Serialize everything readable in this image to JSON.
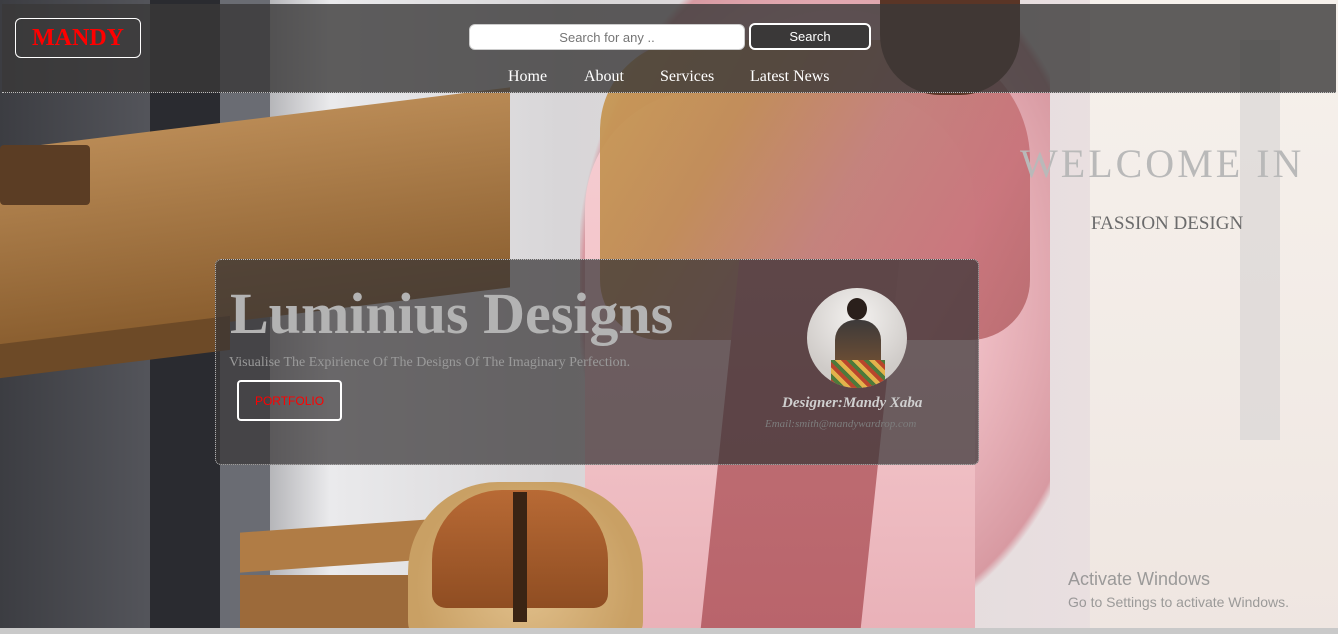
{
  "logo": {
    "text": "MANDY"
  },
  "search": {
    "placeholder": "Search for any ..",
    "button_label": "Search"
  },
  "nav": {
    "items": [
      {
        "label": "Home"
      },
      {
        "label": "About"
      },
      {
        "label": "Services"
      },
      {
        "label": "Latest News"
      }
    ]
  },
  "welcome": {
    "title": "WELCOME IN",
    "subtitle": "FASSION DESIGN"
  },
  "hero": {
    "title": "Luminius Designs",
    "tagline": "Visualise The Expirience Of The Designs Of The Imaginary Perfection.",
    "portfolio_label": "PORTFOLIO",
    "designer": "Designer:Mandy Xaba",
    "email": "Email:smith@mandywardrop.com"
  },
  "watermark": {
    "title": "Activate Windows",
    "subtitle": "Go to Settings to activate Windows."
  },
  "colors": {
    "logo_text": "#ff0000",
    "header_bg": "#3a3838",
    "portfolio_text": "#ff0000"
  }
}
